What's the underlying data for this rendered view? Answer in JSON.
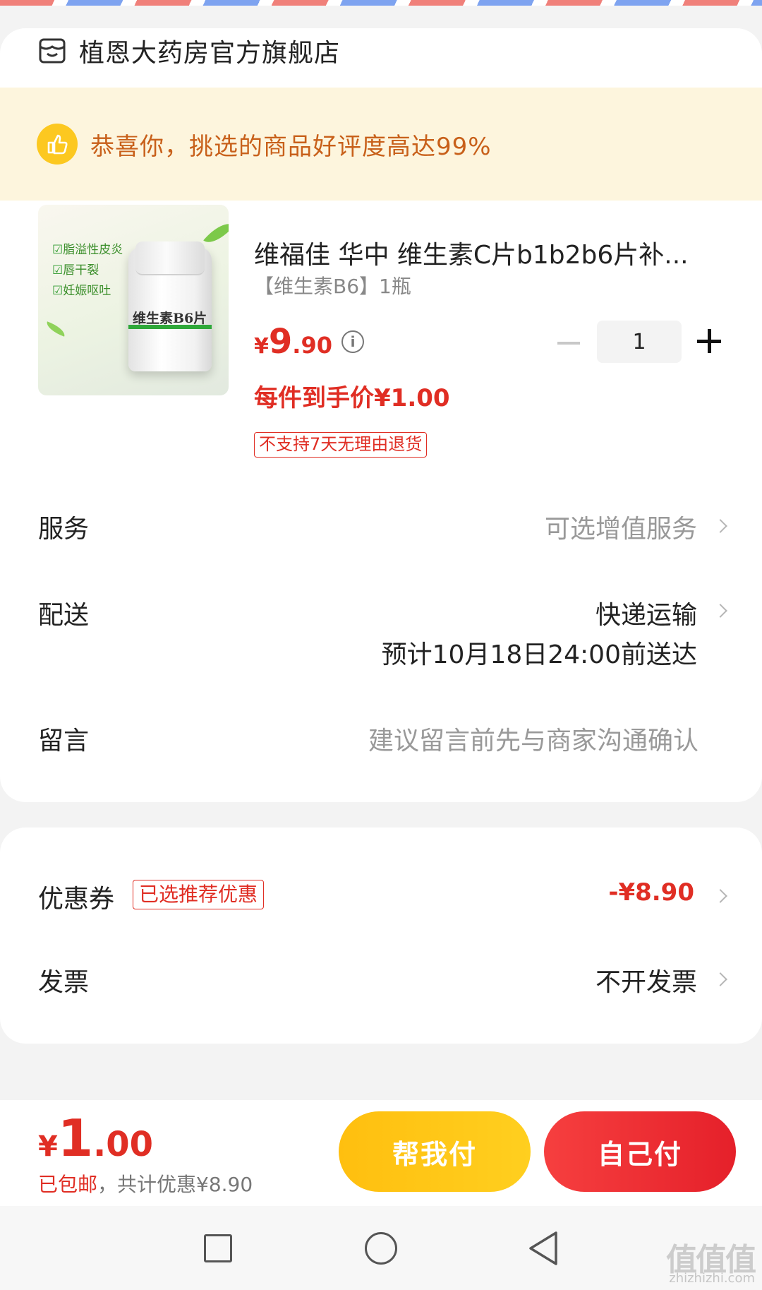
{
  "shop": {
    "name": "植恩大药房官方旗舰店",
    "icon": "store-icon"
  },
  "banner": {
    "icon": "thumbs-up-icon",
    "text": "恭喜你，挑选的商品好评度高达99%"
  },
  "product": {
    "title": "维福佳 华中 维生素C片b1b2b6片补...",
    "spec": "【维生素B6】1瓶",
    "price_currency": "¥",
    "price_int": "9",
    "price_dec": ".90",
    "info_icon": "i",
    "final_price": "每件到手价¥1.00",
    "return_tag": "不支持7天无理由退货",
    "quantity": "1",
    "image": {
      "benefits": [
        "脂溢性皮炎",
        "唇干裂",
        "妊娠呕吐"
      ],
      "bottle_label": "维生素B6片"
    }
  },
  "rows": {
    "service_label": "服务",
    "service_value": "可选增值服务",
    "delivery_label": "配送",
    "delivery_value": "快递运输",
    "delivery_eta": "预计10月18日24:00前送达",
    "message_label": "留言",
    "message_placeholder": "建议留言前先与商家沟通确认"
  },
  "discounts": {
    "coupon_label": "优惠券",
    "coupon_tag": "已选推荐优惠",
    "coupon_value": "-¥8.90",
    "invoice_label": "发票",
    "invoice_value": "不开发票"
  },
  "footer": {
    "total_currency": "¥",
    "total_int": "1",
    "total_dec": ".00",
    "shipping_note": "已包邮",
    "discount_note": "，共计优惠¥8.90",
    "help_pay_label": "帮我付",
    "self_pay_label": "自己付"
  },
  "watermark": {
    "main": "值值值",
    "sub": "zhizhizhi.com"
  },
  "colors": {
    "accent_red": "#e02e24",
    "accent_yellow": "#ffc519",
    "banner_bg": "#fdf5dd"
  }
}
